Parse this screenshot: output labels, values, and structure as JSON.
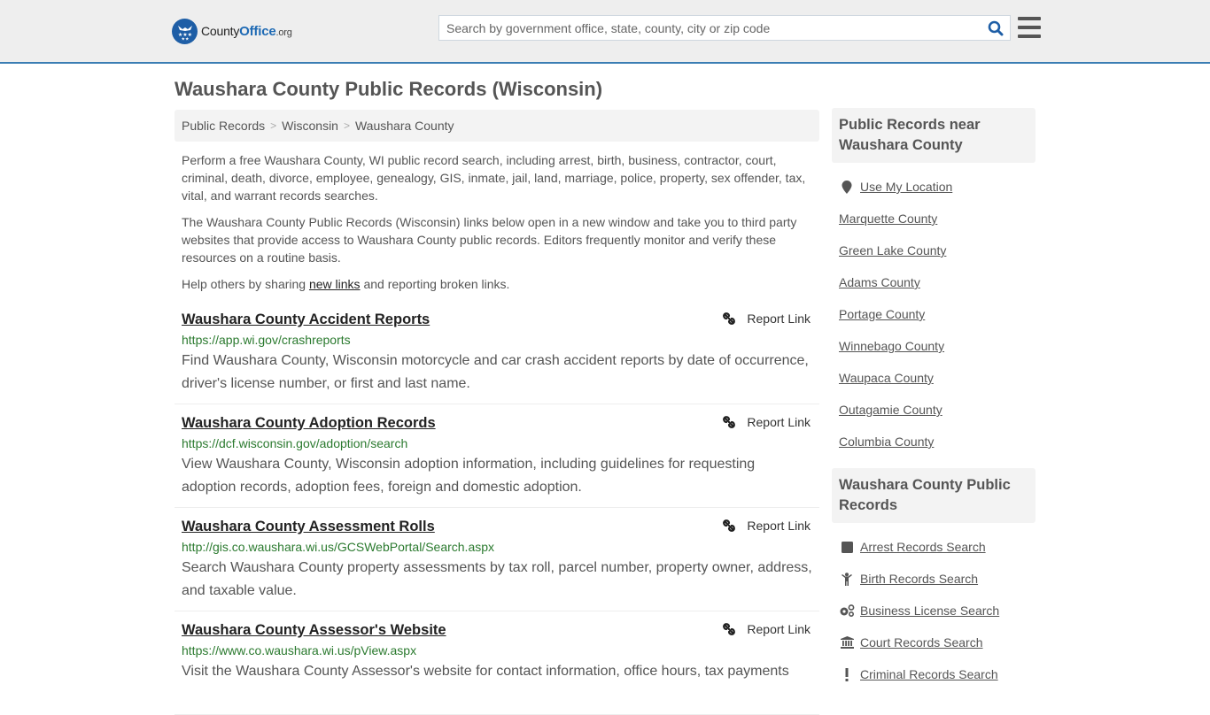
{
  "header": {
    "logo": {
      "name_part1": "County",
      "name_part2": "Office",
      "name_part3": ".org"
    },
    "search": {
      "placeholder": "Search by government office, state, county, city or zip code",
      "value": ""
    },
    "colors": {
      "accent": "#3a7db3",
      "brand": "#1e5ea6"
    }
  },
  "main": {
    "title": "Waushara County Public Records (Wisconsin)",
    "breadcrumb": [
      "Public Records",
      "Wisconsin",
      "Waushara County"
    ],
    "intro": {
      "p1": "Perform a free Waushara County, WI public record search, including arrest, birth, business, contractor, court, criminal, death, divorce, employee, genealogy, GIS, inmate, jail, land, marriage, police, property, sex offender, tax, vital, and warrant records searches.",
      "p2": "The Waushara County Public Records (Wisconsin) links below open in a new window and take you to third party websites that provide access to Waushara County public records. Editors frequently monitor and verify these resources on a routine basis.",
      "p3_before": "Help others by sharing ",
      "p3_link": "new links",
      "p3_after": " and reporting broken links."
    },
    "report_label": "Report Link",
    "records": [
      {
        "title": "Waushara County Accident Reports",
        "url": "https://app.wi.gov/crashreports",
        "description": "Find Waushara County, Wisconsin motorcycle and car crash accident reports by date of occurrence, driver's license number, or first and last name."
      },
      {
        "title": "Waushara County Adoption Records",
        "url": "https://dcf.wisconsin.gov/adoption/search",
        "description": "View Waushara County, Wisconsin adoption information, including guidelines for requesting adoption records, adoption fees, foreign and domestic adoption."
      },
      {
        "title": "Waushara County Assessment Rolls",
        "url": "http://gis.co.waushara.wi.us/GCSWebPortal/Search.aspx",
        "description": "Search Waushara County property assessments by tax roll, parcel number, property owner, address, and taxable value."
      },
      {
        "title": "Waushara County Assessor's Website",
        "url": "https://www.co.waushara.wi.us/pView.aspx",
        "description": "Visit the Waushara County Assessor's website for contact information, office hours, tax payments"
      }
    ]
  },
  "sidebar": {
    "nearby": {
      "heading": "Public Records near Waushara County",
      "use_location": "Use My Location",
      "counties": [
        "Marquette County",
        "Green Lake County",
        "Adams County",
        "Portage County",
        "Winnebago County",
        "Waupaca County",
        "Outagamie County",
        "Columbia County"
      ]
    },
    "county_records": {
      "heading": "Waushara County Public Records",
      "items": [
        {
          "label": "Arrest Records Search",
          "icon": "square-icon"
        },
        {
          "label": "Birth Records Search",
          "icon": "child-icon"
        },
        {
          "label": "Business License Search",
          "icon": "gears-icon"
        },
        {
          "label": "Court Records Search",
          "icon": "courthouse-icon"
        },
        {
          "label": "Criminal Records Search",
          "icon": "exclamation-icon"
        }
      ]
    }
  }
}
